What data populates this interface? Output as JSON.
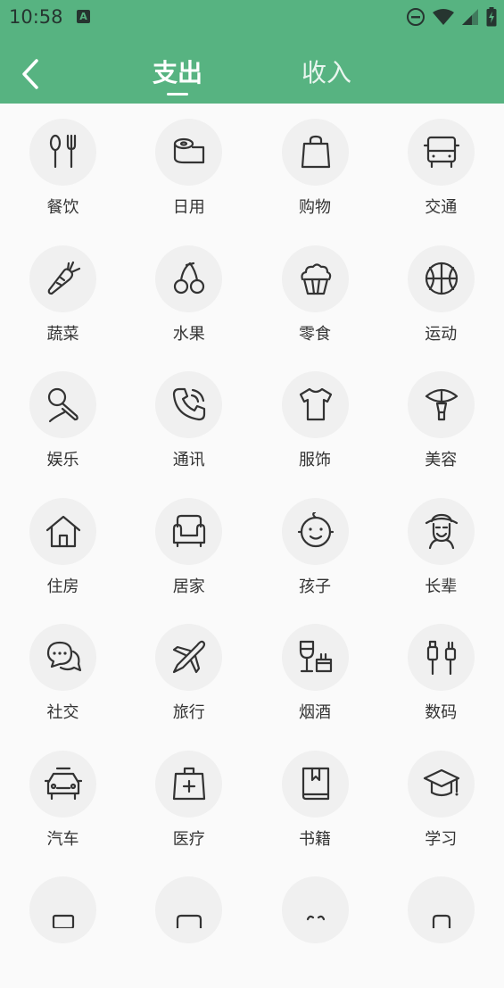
{
  "status_bar": {
    "time": "10:58",
    "notification_icon": "A"
  },
  "app_bar": {
    "tabs": [
      {
        "label": "支出",
        "active": true
      },
      {
        "label": "收入",
        "active": false
      }
    ]
  },
  "categories": [
    {
      "label": "餐饮",
      "icon": "utensils-icon"
    },
    {
      "label": "日用",
      "icon": "tissue-roll-icon"
    },
    {
      "label": "购物",
      "icon": "shopping-bag-icon"
    },
    {
      "label": "交通",
      "icon": "bus-icon"
    },
    {
      "label": "蔬菜",
      "icon": "carrot-icon"
    },
    {
      "label": "水果",
      "icon": "cherry-icon"
    },
    {
      "label": "零食",
      "icon": "cupcake-icon"
    },
    {
      "label": "运动",
      "icon": "basketball-icon"
    },
    {
      "label": "娱乐",
      "icon": "microphone-icon"
    },
    {
      "label": "通讯",
      "icon": "phone-icon"
    },
    {
      "label": "服饰",
      "icon": "tshirt-icon"
    },
    {
      "label": "美容",
      "icon": "makeup-brush-icon"
    },
    {
      "label": "住房",
      "icon": "house-icon"
    },
    {
      "label": "居家",
      "icon": "sofa-icon"
    },
    {
      "label": "孩子",
      "icon": "baby-icon"
    },
    {
      "label": "长辈",
      "icon": "elder-icon"
    },
    {
      "label": "社交",
      "icon": "chat-icon"
    },
    {
      "label": "旅行",
      "icon": "airplane-icon"
    },
    {
      "label": "烟酒",
      "icon": "wine-cigarette-icon"
    },
    {
      "label": "数码",
      "icon": "usb-plug-icon"
    },
    {
      "label": "汽车",
      "icon": "car-icon"
    },
    {
      "label": "医疗",
      "icon": "medical-kit-icon"
    },
    {
      "label": "书籍",
      "icon": "book-icon"
    },
    {
      "label": "学习",
      "icon": "graduation-cap-icon"
    },
    {
      "label": "",
      "icon": "more-icon-1"
    },
    {
      "label": "",
      "icon": "more-icon-2"
    },
    {
      "label": "",
      "icon": "more-icon-3"
    },
    {
      "label": "",
      "icon": "more-icon-4"
    }
  ],
  "colors": {
    "accent": "#57b381",
    "icon_stroke": "#333333",
    "circle_bg": "#f0f0f0"
  }
}
